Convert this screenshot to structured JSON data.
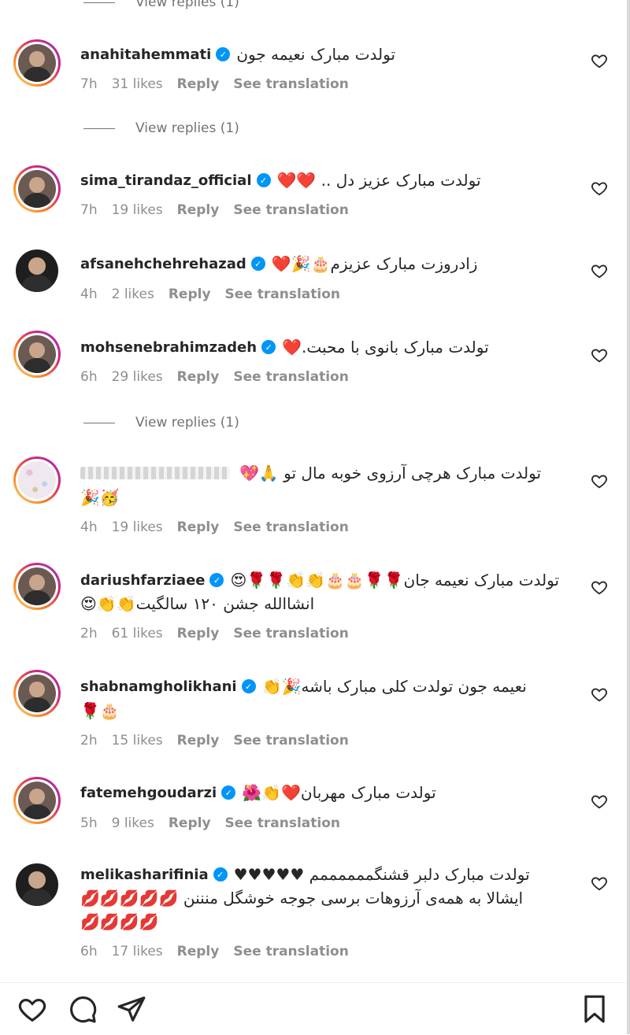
{
  "top_partial_text": "View replies (1)",
  "view_replies_label": "View replies (1)",
  "reply_label": "Reply",
  "see_translation_label": "See translation",
  "comments": [
    {
      "username": "anahitahemmati",
      "text": "تولدت مبارک نعیمه جون",
      "time": "7h",
      "likes": "31 likes"
    },
    {
      "username": "sima_tirandaz_official",
      "text": "تولدت مبارک عزیز دل .. ❤️❤️",
      "time": "7h",
      "likes": "19 likes"
    },
    {
      "username": "afsanehchehrehazad",
      "text": "زادروزت مبارک عزیزم🎂🎉❤️",
      "time": "4h",
      "likes": "2 likes"
    },
    {
      "username": "mohsenebrahimzadeh",
      "text": "تولدت مبارک بانوی با محبت.❤️",
      "time": "6h",
      "likes": "29 likes"
    },
    {
      "username": "",
      "text": "تولدت مبارک هرچی آرزوی خوبه مال تو 🙏💖",
      "text2": "🎉🥳",
      "time": "4h",
      "likes": "19 likes"
    },
    {
      "username": "dariushfarziaee",
      "text": "تولدت مبارک نعیمه جان🌹🌹🎂🎂👏👏🌹🌹😍",
      "text2": "انشاالله جشن ۱۲۰ سالگیت👏👏😍",
      "time": "2h",
      "likes": "61 likes"
    },
    {
      "username": "shabnamgholikhani",
      "text": "نعیمه جون تولدت کلی مبارک باشه🎉👏",
      "text2": "🌹🎂",
      "time": "2h",
      "likes": "15 likes"
    },
    {
      "username": "fatemehgoudarzi",
      "text": "تولدت مبارک مهربان❤️👏🌺",
      "time": "5h",
      "likes": "9 likes"
    },
    {
      "username": "melikasharifinia",
      "text": "تولدت مبارک دلبر قشنگممممممم ♥♥♥♥♥",
      "text2": "ایشالا به همه‌ی آرزوهات برسی جوجه خوشگل منننن 💋💋💋💋💋",
      "text3": "💋💋💋💋",
      "time": "6h",
      "likes": "17 likes"
    }
  ]
}
